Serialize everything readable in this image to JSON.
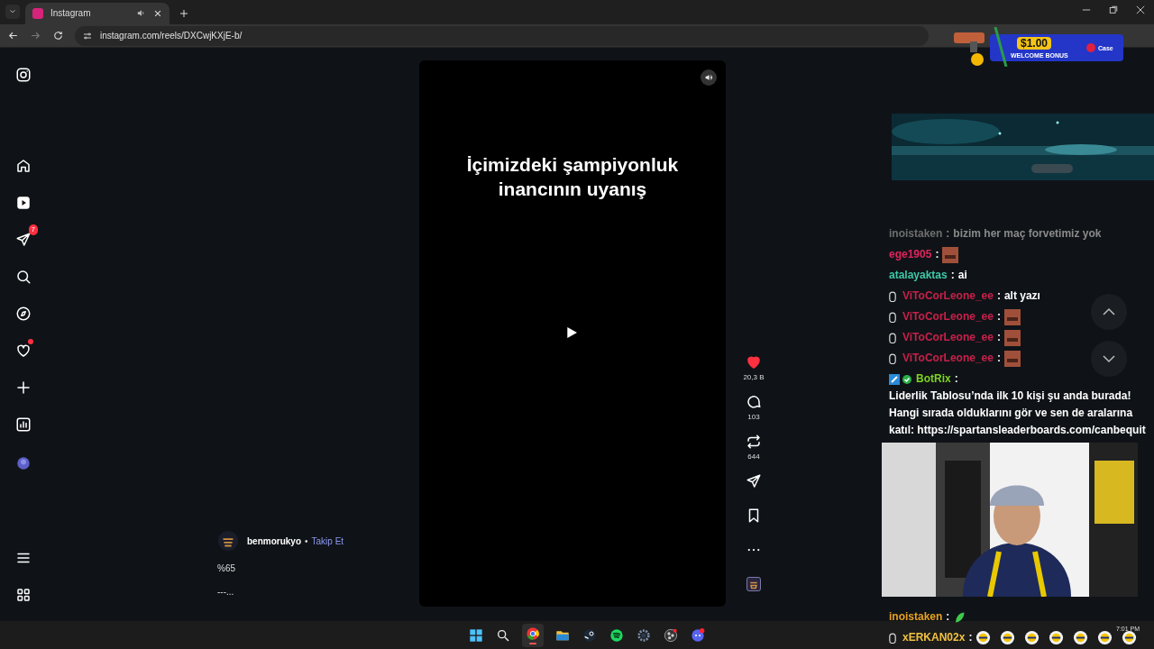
{
  "browser": {
    "tab": {
      "title": "Instagram",
      "selected": true
    },
    "address": "instagram.com/reels/DXCwjKXjE-b/"
  },
  "sidebar": {
    "items": [
      {
        "kind": "instagram"
      },
      {
        "kind": "home"
      },
      {
        "kind": "reels"
      },
      {
        "kind": "send",
        "badge": "7"
      },
      {
        "kind": "search"
      },
      {
        "kind": "compass"
      },
      {
        "kind": "heart",
        "dot": true
      },
      {
        "kind": "plus"
      },
      {
        "kind": "chart"
      },
      {
        "kind": "avatar"
      },
      {
        "kind": "menu"
      },
      {
        "kind": "apps"
      }
    ]
  },
  "reel": {
    "caption_overlay": "İçimizdeki şampiyonluk inancının uyanış",
    "author": "benmorukyo",
    "separator": "•",
    "follow": "Takip Et",
    "caption": "%65",
    "more": "---...",
    "muted": false
  },
  "actions": [
    {
      "kind": "heart",
      "count": "20,3 B",
      "liked": true
    },
    {
      "kind": "comment",
      "count": "103"
    },
    {
      "kind": "repost",
      "count": "644"
    },
    {
      "kind": "send"
    },
    {
      "kind": "bookmark"
    },
    {
      "kind": "more"
    },
    {
      "kind": "audio"
    }
  ],
  "overlay": {
    "ad": {
      "amount": "$1.00",
      "label": "WELCOME BONUS",
      "brand": "Case"
    },
    "chat": [
      {
        "user": "inoistaken",
        "color": "#6e6e6e",
        "faded": true,
        "separator": ":",
        "parts": [
          {
            "kind": "text",
            "text": "bizim her maç forvetimiz yok"
          }
        ]
      },
      {
        "user": "ege1905",
        "color": "#e0245e",
        "faded": false,
        "separator": ":",
        "parts": [
          {
            "kind": "emote"
          }
        ]
      },
      {
        "user": "atalayaktas",
        "color": "#3ec9a7",
        "faded": false,
        "separator": ":",
        "parts": [
          {
            "kind": "text",
            "text": "ai"
          }
        ]
      },
      {
        "user": "ViToCorLeone_ee",
        "color": "#c8204a",
        "faded": false,
        "badge": true,
        "separator": ":",
        "parts": [
          {
            "kind": "text",
            "text": "alt yazı"
          }
        ]
      },
      {
        "user": "ViToCorLeone_ee",
        "color": "#c8204a",
        "faded": false,
        "badge": true,
        "separator": ":",
        "parts": [
          {
            "kind": "emote"
          }
        ]
      },
      {
        "user": "ViToCorLeone_ee",
        "color": "#c8204a",
        "faded": false,
        "badge": true,
        "separator": ":",
        "parts": [
          {
            "kind": "emote"
          }
        ]
      },
      {
        "user": "ViToCorLeone_ee",
        "color": "#c8204a",
        "faded": false,
        "badge": true,
        "separator": ":",
        "parts": [
          {
            "kind": "emote"
          }
        ]
      },
      {
        "user": "BotRix",
        "color": "#7ed321",
        "faded": false,
        "bot": true,
        "separator": ":",
        "parts": [
          {
            "kind": "text",
            "text": "Liderlik Tablosu’nda ilk 10 kişi şu anda burada! Hangi sırada olduklarını gör ve sen de aralarına katıl: https://spartansleaderboards.com/canbequit"
          }
        ]
      }
    ],
    "chat_bottom": [
      {
        "user": "inoistaken",
        "color": "#e8a020",
        "faded": false,
        "separator": ":",
        "parts": [
          {
            "kind": "leaf"
          }
        ]
      },
      {
        "user": "xERKAN02x",
        "color": "#f0c040",
        "faded": false,
        "badge": true,
        "separator": ":",
        "parts": [
          {
            "kind": "crest"
          },
          {
            "kind": "crest"
          },
          {
            "kind": "crest"
          },
          {
            "kind": "crest"
          },
          {
            "kind": "crest"
          },
          {
            "kind": "crest"
          },
          {
            "kind": "crest"
          }
        ]
      }
    ]
  },
  "taskbar": {
    "apps": [
      {
        "kind": "windows",
        "selected": false
      },
      {
        "kind": "search",
        "selected": false
      },
      {
        "kind": "chrome",
        "selected": true
      },
      {
        "kind": "folder",
        "selected": false
      },
      {
        "kind": "steam",
        "selected": false
      },
      {
        "kind": "spotify",
        "selected": false
      },
      {
        "kind": "gear",
        "selected": false
      },
      {
        "kind": "obs",
        "selected": false
      },
      {
        "kind": "discord",
        "selected": false
      }
    ],
    "time": "7:01 PM"
  }
}
